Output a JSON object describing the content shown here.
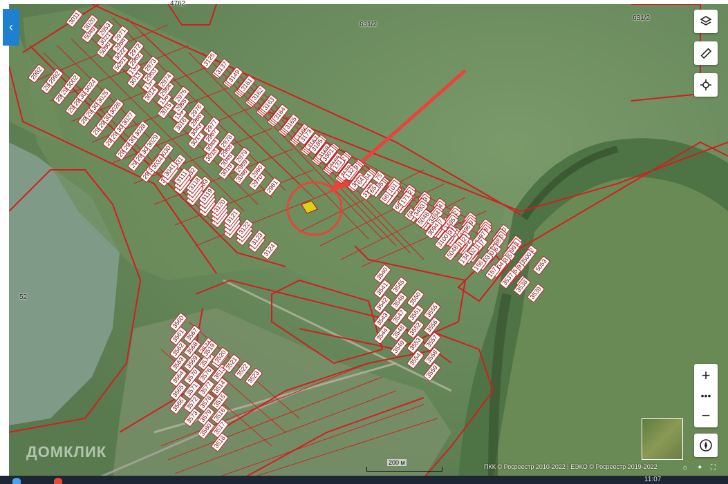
{
  "map": {
    "plot_labels": [
      "3011",
      "5049",
      "5050",
      "5051",
      "3013",
      "3014",
      "3015",
      "3016",
      "3017",
      "3018",
      "3019",
      "3020",
      "3021",
      "3022",
      "136",
      "137",
      "138",
      "139",
      "3043",
      "3044",
      "3045",
      "3046",
      "2953",
      "2954",
      "2962",
      "2963",
      "2964",
      "2965",
      "2966",
      "2967",
      "2968",
      "2969",
      "2970",
      "2971",
      "2972",
      "2973",
      "2974",
      "2975",
      "2976",
      "2977",
      "2978",
      "2979",
      "2980",
      "2981",
      "2982",
      "2983",
      "2984",
      "2985",
      "2986",
      "2987",
      "2988",
      "2989",
      "2990",
      "2991",
      "2992",
      "2993",
      "2994",
      "2995",
      "2996",
      "2997",
      "2998",
      "2999",
      "3000",
      "3001",
      "3002",
      "3003",
      "3004",
      "3005",
      "3006",
      "3007",
      "3008",
      "3009",
      "3010",
      "3023",
      "3024",
      "3025",
      "3026",
      "3027",
      "3028",
      "3029",
      "3030",
      "3031",
      "3032",
      "3033",
      "3034",
      "3035",
      "3036",
      "3037",
      "3038",
      "3039",
      "3040",
      "3041",
      "3042",
      "3106",
      "3107",
      "3108",
      "3109",
      "3110",
      "3111",
      "3112",
      "3113",
      "3114",
      "3115",
      "3116",
      "3117",
      "3118",
      "3119",
      "3120",
      "3121",
      "3122",
      "3123",
      "3124",
      "3125",
      "3126",
      "3127",
      "3128",
      "3129",
      "3130",
      "3131",
      "3132",
      "3133",
      "3134",
      "3135",
      "3136",
      "3137",
      "3138",
      "3139",
      "3140",
      "3141",
      "3142",
      "3143",
      "3144",
      "3145",
      "3146",
      "3147",
      "3148",
      "3149",
      "3150",
      "3151",
      "3152",
      "3153",
      "3154",
      "3155",
      "3156",
      "3157",
      "3158",
      "3159",
      "3160",
      "3161",
      "3162",
      "3163",
      "3164",
      "3165",
      "3166",
      "3167",
      "3168",
      "3169",
      "3170",
      "3171",
      "3172",
      "3173",
      "3174",
      "3175",
      "3176",
      "3177",
      "3178",
      "3179",
      "3180",
      "3181",
      "3182",
      "3183",
      "3184",
      "3185",
      "3186",
      "3187",
      "3188",
      "3189",
      "3190",
      "3191",
      "3192",
      "3193",
      "3194",
      "3195",
      "3300",
      "3301",
      "3302",
      "3303",
      "3304",
      "3305",
      "3306",
      "3307",
      "3308",
      "2922",
      "3242",
      "3241",
      "3202",
      "131",
      "132",
      "64",
      "65",
      "66",
      "68",
      "69",
      "70",
      "71",
      "72",
      "73",
      "74",
      "75",
      "76",
      "77",
      "78",
      "79",
      "80",
      "98",
      "99",
      "100",
      "101",
      "102",
      "103",
      "104",
      "162",
      "163",
      "164",
      "165",
      "166",
      "171",
      "172",
      "174",
      "175",
      "3489",
      "3488",
      "3490",
      "3491",
      "3492",
      "3493",
      "3494",
      "3495",
      "3496",
      "3497",
      "3498",
      "3499",
      "3500",
      "5053",
      "5048",
      "5047",
      "139",
      "140",
      "3097",
      "3096",
      "3095",
      "3094",
      "3093",
      "3092",
      "3091",
      "3090",
      "3098",
      "3099",
      "3100",
      "3101",
      "3102",
      "3103",
      "3104",
      "3105",
      "57",
      "5048",
      "134",
      "156",
      "157",
      "3537",
      "3538",
      "3539",
      "3540",
      "3541",
      "3542",
      "3543",
      "3544",
      "3545",
      "3546",
      "3547",
      "3548",
      "3549",
      "3550",
      "3551",
      "3552",
      "3553",
      "3554",
      "3555",
      "3556",
      "3557",
      "3558",
      "3559",
      "3560",
      "3561",
      "3562",
      "3563",
      "3564",
      "3565",
      "3566",
      "3567",
      "3568",
      "3569",
      "3570",
      "3571",
      "3572",
      "3573",
      "3574",
      "3575",
      "3576",
      "3577",
      "3578",
      "3579",
      "3580",
      "3512",
      "3513",
      "3514",
      "3515",
      "3516",
      "3517",
      "3518",
      "3519",
      "3520",
      "3521",
      "3522",
      "3523"
    ],
    "region_labels": [
      "631/2",
      "631/2",
      "52",
      "4762"
    ]
  },
  "controls": {
    "layers_icon": "layers-icon",
    "ruler_icon": "ruler-icon",
    "locate_icon": "crosshair-icon",
    "zoom_in": "+",
    "zoom_more": "•••",
    "zoom_out": "−",
    "compass_icon": "compass-icon",
    "collapse_glyph": "‹"
  },
  "footer": {
    "attribution": "ПКК © Росреестр 2010-2022 | ЕЭКО © Росреестр 2019-2022",
    "scale": "200 м",
    "watermark": "ДОМКЛИК",
    "clock": "11:07"
  },
  "colors": {
    "boundary": "#d11f1f",
    "highlight_plot": "#d9d21a",
    "annotation": "#e8443a",
    "panel_tab": "#1f7fd0"
  }
}
